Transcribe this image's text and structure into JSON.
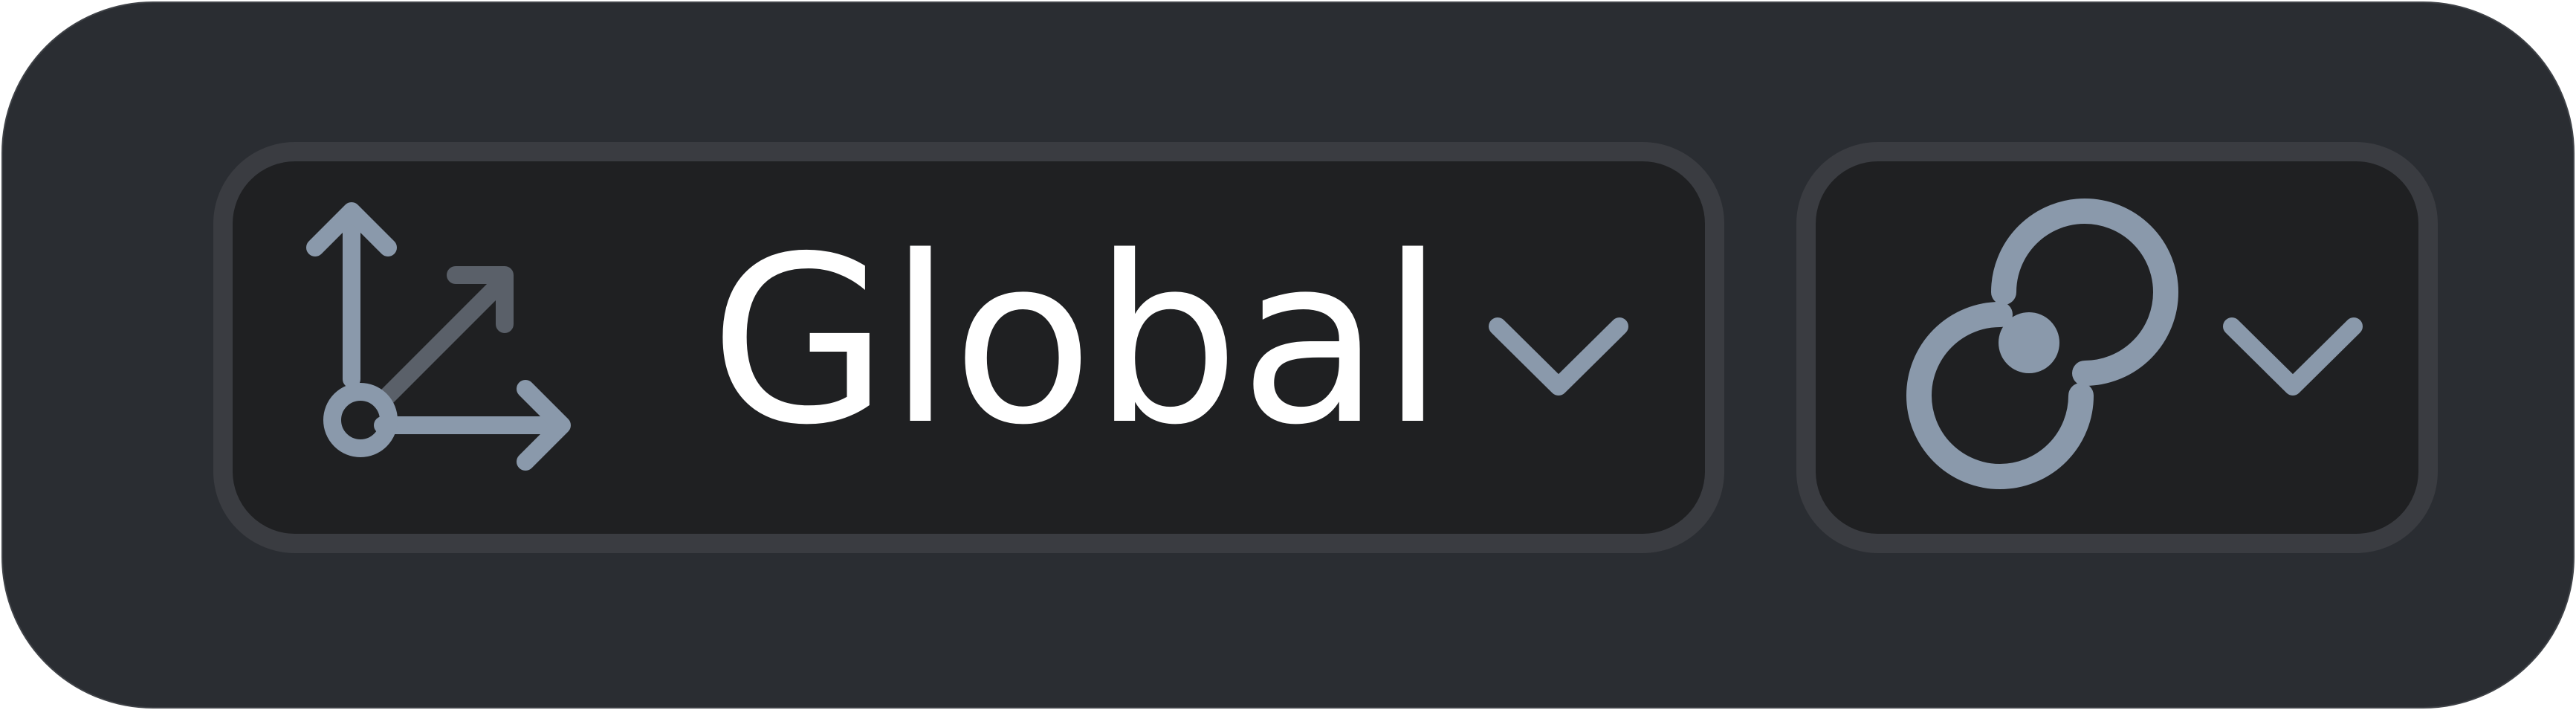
{
  "transform_orientation": {
    "selected_label": "Global",
    "icon": "orientation-global-axes-icon",
    "dropdown_icon": "chevron-down-icon"
  },
  "pivot_point": {
    "icon": "pivot-point-icon",
    "dropdown_icon": "chevron-down-icon"
  },
  "colors": {
    "bar_background": "#2a2d32",
    "dropdown_background": "#1f2022",
    "dropdown_border": "#3a3c41",
    "icon_primary": "#8a99ab",
    "icon_secondary": "#5a6069",
    "label_text": "#ffffff"
  }
}
